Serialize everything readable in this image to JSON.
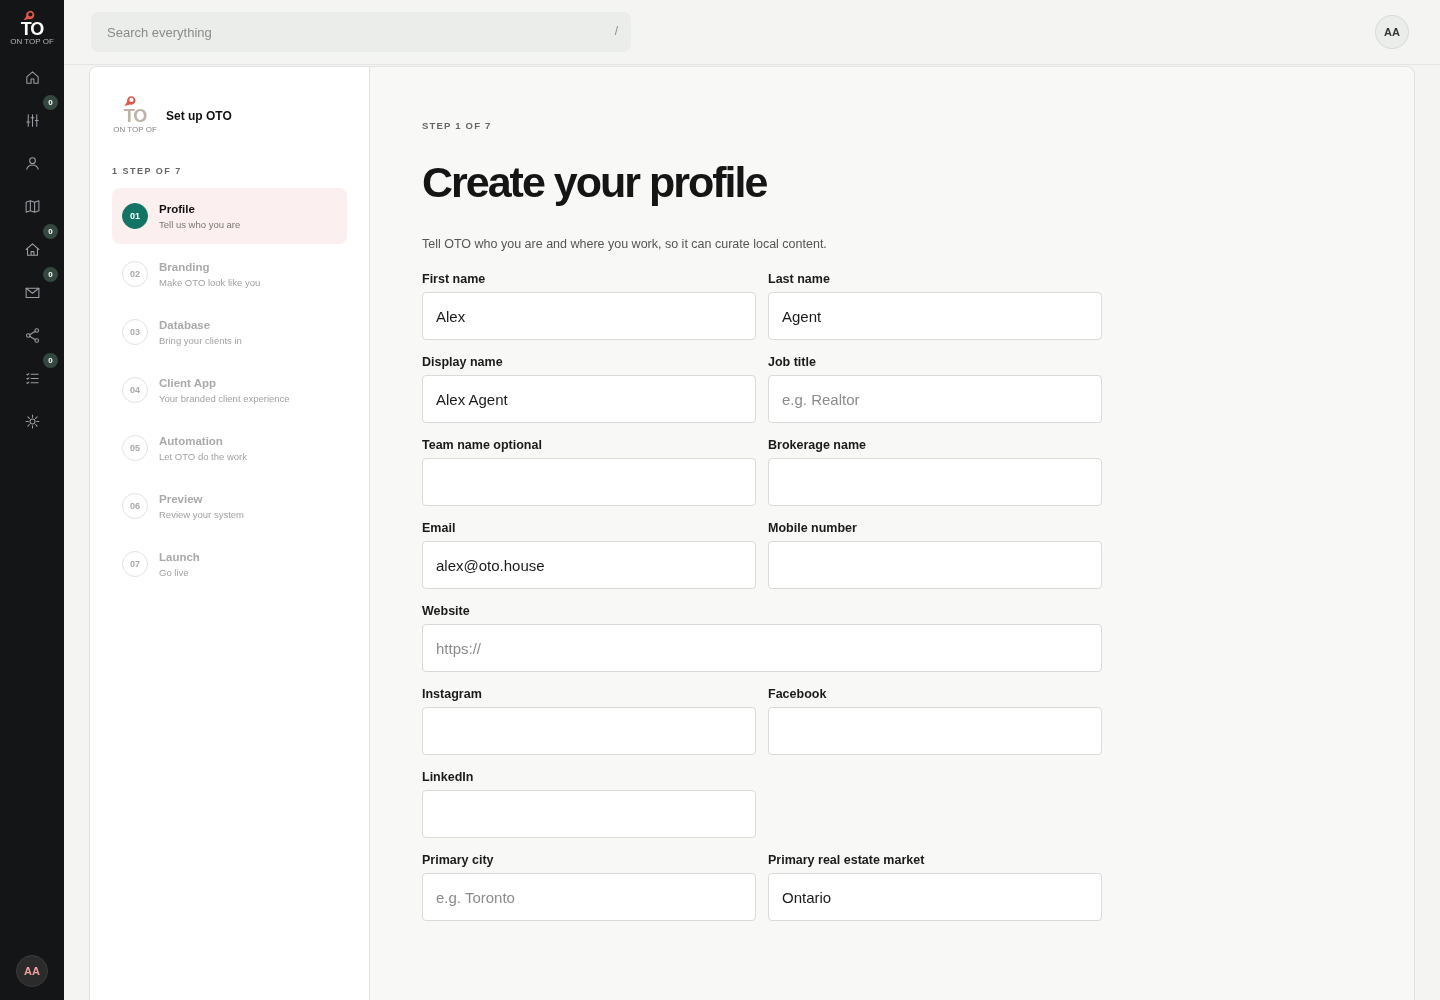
{
  "logo": {
    "mark": "TO",
    "tagline": "ON TOP OF"
  },
  "nav": [
    {
      "kind": "home"
    },
    {
      "kind": "sliders",
      "badge": "0"
    },
    {
      "kind": "person"
    },
    {
      "kind": "map"
    },
    {
      "kind": "house",
      "badge": "0"
    },
    {
      "kind": "mail",
      "badge": "0"
    },
    {
      "kind": "share"
    },
    {
      "kind": "checklist",
      "badge": "0"
    },
    {
      "kind": "settings"
    }
  ],
  "user_avatar": "AA",
  "search": {
    "placeholder": "Search everything",
    "shortcut": "/"
  },
  "top_avatar": "AA",
  "setup": {
    "logo_mark": "TO",
    "logo_tagline": "ON TOP OF",
    "title": "Set up OTO",
    "progress": "1 STEP OF 7",
    "steps": [
      {
        "number": "01",
        "title": "Profile",
        "subtitle": "Tell us who you are",
        "selected": true
      },
      {
        "number": "02",
        "title": "Branding",
        "subtitle": "Make OTO look like you",
        "selected": false
      },
      {
        "number": "03",
        "title": "Database",
        "subtitle": "Bring your clients in",
        "selected": false
      },
      {
        "number": "04",
        "title": "Client App",
        "subtitle": "Your branded client experience",
        "selected": false
      },
      {
        "number": "05",
        "title": "Automation",
        "subtitle": "Let OTO do the work",
        "selected": false
      },
      {
        "number": "06",
        "title": "Preview",
        "subtitle": "Review your system",
        "selected": false
      },
      {
        "number": "07",
        "title": "Launch",
        "subtitle": "Go live",
        "selected": false
      }
    ]
  },
  "form": {
    "step": "STEP 1 OF 7",
    "title": "Create your profile",
    "intro": "Tell OTO who you are and where you work, so it can curate local content.",
    "rows": [
      [
        {
          "label": "First name",
          "value": "Alex"
        },
        {
          "label": "Last name",
          "value": "Agent"
        }
      ],
      [
        {
          "label": "Display name",
          "value": "Alex Agent"
        },
        {
          "label": "Job title",
          "placeholder": "e.g. Realtor"
        }
      ],
      [
        {
          "label": "Team name optional"
        },
        {
          "label": "Brokerage name"
        }
      ],
      [
        {
          "label": "Email",
          "value": "alex@oto.house"
        },
        {
          "label": "Mobile number"
        }
      ],
      [
        {
          "label": "Website",
          "placeholder": "https://"
        }
      ],
      [
        {
          "label": "Instagram"
        },
        {
          "label": "Facebook"
        }
      ],
      [
        {
          "label": "LinkedIn"
        }
      ],
      [
        {
          "label": "Primary city",
          "placeholder": "e.g. Toronto"
        },
        {
          "label": "Primary real estate market",
          "value": "Ontario"
        }
      ]
    ]
  }
}
